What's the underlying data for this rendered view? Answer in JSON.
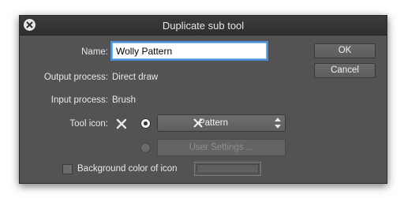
{
  "dialog": {
    "title": "Duplicate sub tool",
    "name_label": "Name:",
    "name_value": "Wolly Pattern",
    "output_label": "Output process:",
    "output_value": "Direct draw",
    "input_label": "Input process:",
    "input_value": "Brush",
    "tool_icon_label": "Tool icon:",
    "icon_select_value": "Pattern",
    "user_settings_label": "User Settings ...",
    "bg_color_label": "Background color of icon",
    "ok_label": "OK",
    "cancel_label": "Cancel"
  },
  "icons": {
    "close": "close-icon",
    "tool": "pattern-tool-icon"
  }
}
